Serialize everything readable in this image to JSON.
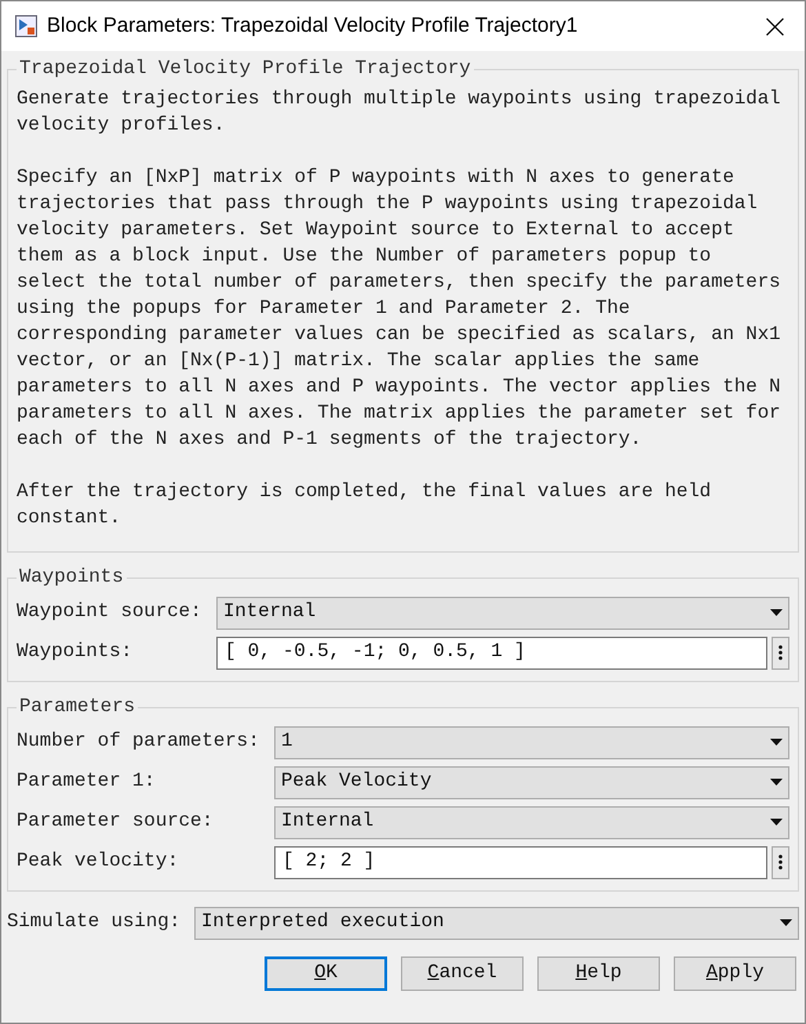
{
  "window": {
    "title": "Block Parameters: Trapezoidal Velocity Profile Trajectory1"
  },
  "description": {
    "heading": "Trapezoidal Velocity Profile Trajectory",
    "paragraphs": [
      "Generate trajectories through multiple waypoints using trapezoidal velocity profiles.",
      "Specify an [NxP] matrix of P waypoints with N axes to generate trajectories that pass through the P waypoints using trapezoidal velocity parameters. Set Waypoint source to External to accept them as a block input. Use the Number of parameters popup to select the total number of parameters, then specify the parameters using the popups for Parameter 1 and Parameter 2. The corresponding parameter values can be specified as scalars, an Nx1 vector, or an [Nx(P-1)] matrix. The scalar applies the same parameters to all N axes and P waypoints. The vector applies the N parameters to all N axes. The matrix applies the parameter set for each of the N axes and P-1 segments of the trajectory.",
      "After the trajectory is completed, the final values are held constant."
    ]
  },
  "groups": [
    {
      "title": "Waypoints",
      "rows": [
        {
          "kind": "dropdown",
          "label": "Waypoint source:",
          "value": "Internal"
        },
        {
          "kind": "text",
          "label": "Waypoints:",
          "value": "[ 0, -0.5, -1; 0, 0.5, 1 ]"
        }
      ]
    },
    {
      "title": "Parameters",
      "rows": [
        {
          "kind": "dropdown",
          "label": "Number of parameters:",
          "value": "1"
        },
        {
          "kind": "dropdown",
          "label": "Parameter 1:",
          "value": "Peak Velocity"
        },
        {
          "kind": "dropdown",
          "label": "Parameter source:",
          "value": "Internal"
        },
        {
          "kind": "text",
          "label": "Peak velocity:",
          "value": "[ 2; 2 ]"
        }
      ]
    }
  ],
  "simulate": {
    "label": "Simulate using:",
    "value": "Interpreted execution"
  },
  "buttons": [
    {
      "label": "OK",
      "selected": true
    },
    {
      "label": "Cancel",
      "selected": false
    },
    {
      "label": "Help",
      "selected": false
    },
    {
      "label": "Apply",
      "selected": false
    }
  ]
}
